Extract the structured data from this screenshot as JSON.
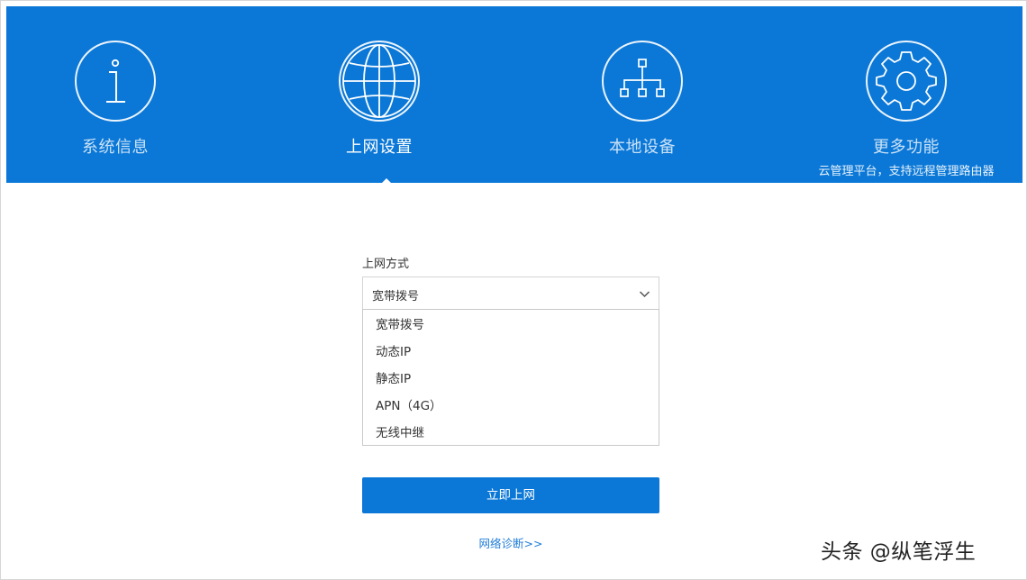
{
  "nav": [
    {
      "label": "系统信息",
      "icon": "info-icon",
      "active": false
    },
    {
      "label": "上网设置",
      "icon": "globe-icon",
      "active": true
    },
    {
      "label": "本地设备",
      "icon": "network-tree-icon",
      "active": false
    },
    {
      "label": "更多功能",
      "icon": "gear-icon",
      "active": false,
      "sublabel": "云管理平台，支持远程管理路由器"
    }
  ],
  "form": {
    "label": "上网方式",
    "selected": "宽带拨号",
    "options": [
      "宽带拨号",
      "动态IP",
      "静态IP",
      "APN（4G）",
      "无线中继"
    ]
  },
  "actions": {
    "connect_label": "立即上网",
    "diagnose_label": "网络诊断>>"
  },
  "watermark": "头条 @纵笔浮生",
  "colors": {
    "accent": "#0b78d7",
    "link": "#1f7cd8"
  }
}
